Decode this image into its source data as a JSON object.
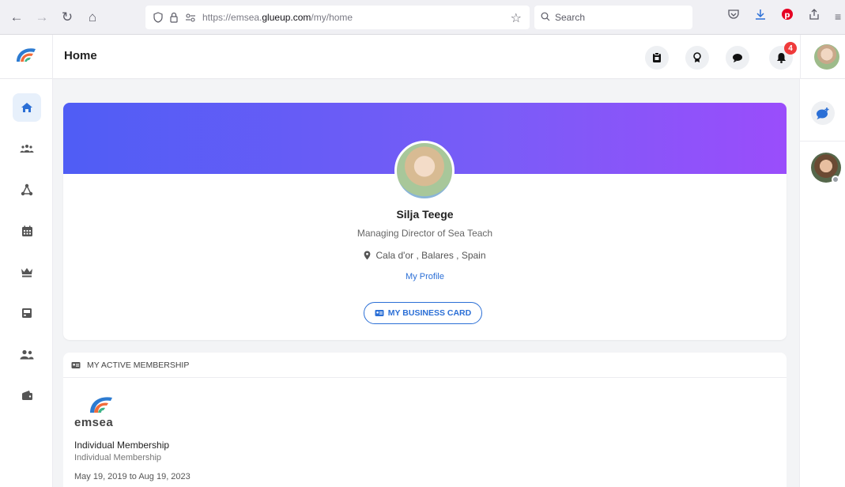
{
  "browser": {
    "url_prefix": "https://emsea.",
    "url_host": "glueup.com",
    "url_path": "/my/home",
    "search_placeholder": "Search"
  },
  "header": {
    "title": "Home",
    "notification_count": "4"
  },
  "profile": {
    "name": "Silja Teege",
    "job_title": "Managing Director of Sea Teach",
    "location": "Cala d'or , Balares , Spain",
    "profile_link": "My Profile",
    "business_card_label": "MY BUSINESS CARD"
  },
  "membership": {
    "section_title": "MY ACTIVE MEMBERSHIP",
    "org_word": "emsea",
    "title": "Individual Membership",
    "subtitle": "Individual Membership",
    "dates": "May 19, 2019 to Aug 19, 2023"
  },
  "colors": {
    "accent": "#2b6fd6",
    "banner_start": "#4f5df5",
    "banner_end": "#9a4dfb",
    "badge": "#ef3b3b"
  },
  "icons": {
    "sidebar": [
      "home-icon",
      "groups-icon",
      "network-icon",
      "calendar-icon",
      "crown-icon",
      "inbox-icon",
      "people-icon",
      "wallet-icon"
    ],
    "header": [
      "tasks-icon",
      "award-icon",
      "chat-icon",
      "bell-icon"
    ]
  }
}
